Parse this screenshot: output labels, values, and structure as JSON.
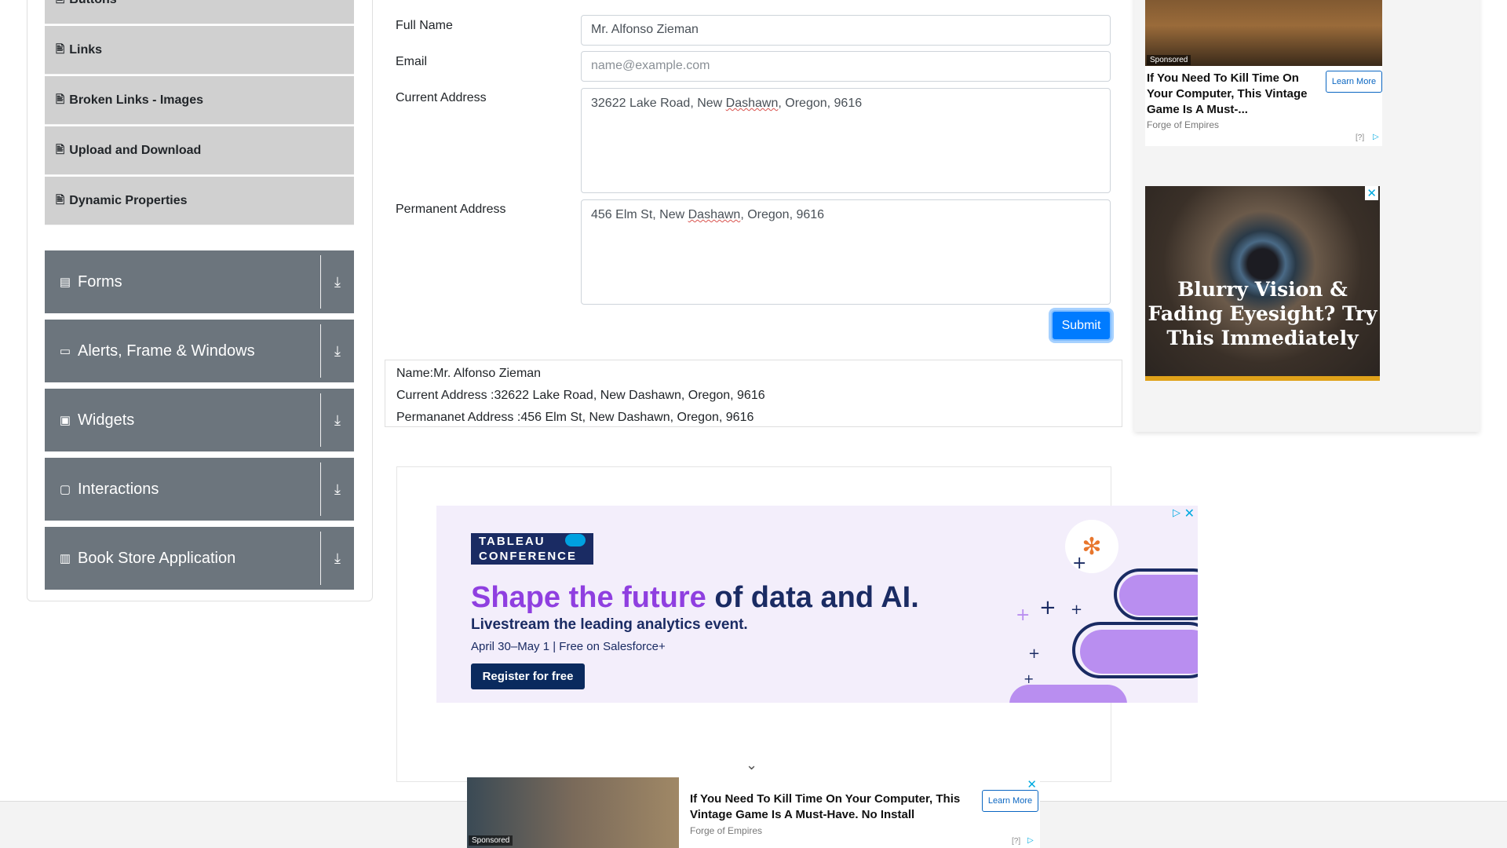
{
  "sidebar": {
    "sub_items": [
      {
        "icon": "document-icon",
        "glyph": "🖹",
        "label": "Buttons"
      },
      {
        "icon": "document-icon",
        "glyph": "🖹",
        "label": "Links"
      },
      {
        "icon": "document-icon",
        "glyph": "🖹",
        "label": "Broken Links - Images"
      },
      {
        "icon": "document-icon",
        "glyph": "🖹",
        "label": "Upload and Download"
      },
      {
        "icon": "document-icon",
        "glyph": "🖹",
        "label": "Dynamic Properties"
      }
    ],
    "groups": [
      {
        "icon": "form-icon",
        "glyph": "▤",
        "label": "Forms"
      },
      {
        "icon": "window-icon",
        "glyph": "▭",
        "label": "Alerts, Frame & Windows"
      },
      {
        "icon": "widgets-icon",
        "glyph": "▣",
        "label": "Widgets"
      },
      {
        "icon": "interactions-icon",
        "glyph": "▢",
        "label": "Interactions"
      },
      {
        "icon": "books-icon",
        "glyph": "▥",
        "label": "Book Store Application"
      }
    ],
    "download_glyph": "⤓"
  },
  "form": {
    "full_name_label": "Full Name",
    "full_name_value": "Mr. Alfonso Zieman",
    "email_label": "Email",
    "email_placeholder": "name@example.com",
    "current_address_label": "Current Address",
    "current_address_pre": "32622 Lake Road, New ",
    "current_address_misspelled": "Dashawn",
    "current_address_post": ", Oregon, 9616",
    "permanent_address_label": "Permanent Address",
    "permanent_address_pre": "456 Elm St, New ",
    "permanent_address_misspelled": "Dashawn",
    "permanent_address_post": ", Oregon, 9616",
    "submit_label": "Submit"
  },
  "output": {
    "name_line": "Name:Mr. Alfonso Zieman",
    "current_line": "Current Address :32622 Lake Road, New Dashawn, Oregon, 9616",
    "permanent_line": "Permananet Address :456 Elm St, New Dashawn, Oregon, 9616"
  },
  "tableau_ad": {
    "logo_line1": "TABLEAU",
    "logo_line2": "CONFERENCE",
    "headline_highlight": "Shape the future",
    "headline_rest": " of data and AI.",
    "subheadline": "Livestream the leading analytics event.",
    "date_line": "April 30–May 1 | Free on Salesforce+",
    "cta": "Register for free",
    "close_glyph": "✕",
    "adchoices_glyph": "▷"
  },
  "right_ad_1": {
    "sponsored": "Sponsored",
    "title": "If You Need To Kill Time On Your Computer, This Vintage Game Is A Must-...",
    "learn_more": "Learn More",
    "source": "Forge of Empires",
    "adinfo": "[?]"
  },
  "right_ad_2": {
    "text": "Blurry Vision & Fading Eyesight? Try This Immediately",
    "close_glyph": "✕"
  },
  "bottom_ad": {
    "sponsored": "Sponsored",
    "title": "If You Need To Kill Time On Your Computer, This Vintage Game Is A Must-Have. No Install",
    "learn_more": "Learn More",
    "source": "Forge of Empires",
    "adinfo": "[?]",
    "close_glyph": "✕"
  },
  "chevron_glyph": "⌄",
  "colors": {
    "primary": "#007bff",
    "sidebar_group": "#6c757d",
    "sidebar_sub": "#d0d0d0"
  }
}
